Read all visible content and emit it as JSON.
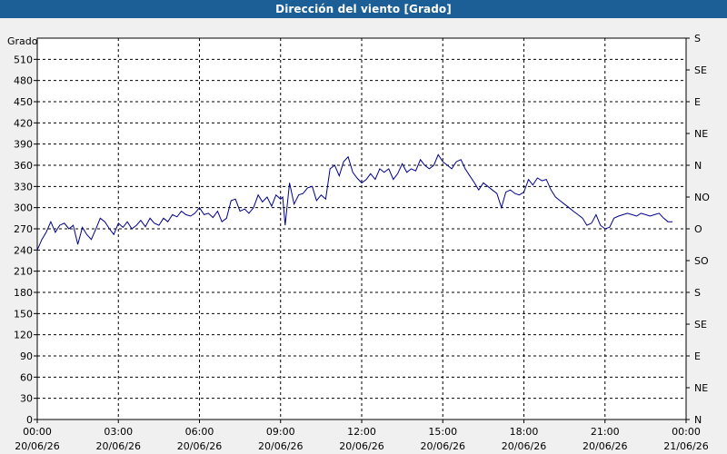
{
  "window": {
    "title": "Dirección del viento [Grado]"
  },
  "chart_data": {
    "type": "line",
    "title": "Dirección del viento [Grado]",
    "ylabel": "Grado",
    "xlabel": "",
    "ylim": [
      0,
      540
    ],
    "xlim": [
      "2026-06-20 00:00",
      "2026-06-21 00:00"
    ],
    "grid": true,
    "line_color": "#00008b",
    "y_ticks": [
      0,
      30,
      60,
      90,
      120,
      150,
      180,
      210,
      240,
      270,
      300,
      330,
      360,
      390,
      420,
      450,
      480,
      510
    ],
    "y_right_ticks": [
      "N",
      "NE",
      "E",
      "SE",
      "S",
      "SO",
      "O",
      "NO",
      "N",
      "NE",
      "E",
      "SE",
      "S"
    ],
    "y_right_tick_values": [
      0,
      45,
      90,
      135,
      180,
      225,
      270,
      315,
      360,
      405,
      450,
      495,
      540
    ],
    "x_ticks": [
      {
        "time": "00:00",
        "date": "20/06/26"
      },
      {
        "time": "03:00",
        "date": "20/06/26"
      },
      {
        "time": "06:00",
        "date": "20/06/26"
      },
      {
        "time": "09:00",
        "date": "20/06/26"
      },
      {
        "time": "12:00",
        "date": "20/06/26"
      },
      {
        "time": "15:00",
        "date": "20/06/26"
      },
      {
        "time": "18:00",
        "date": "20/06/26"
      },
      {
        "time": "21:00",
        "date": "20/06/26"
      },
      {
        "time": "00:00",
        "date": "21/06/26"
      }
    ],
    "series": [
      {
        "x_hours": [
          0,
          0.17,
          0.33,
          0.5,
          0.67,
          0.83,
          1,
          1.17,
          1.33,
          1.5,
          1.67,
          1.83,
          2,
          2.17,
          2.33,
          2.5,
          2.67,
          2.83,
          3,
          3.17,
          3.33,
          3.5,
          3.67,
          3.83,
          4,
          4.17,
          4.33,
          4.5,
          4.67,
          4.83,
          5,
          5.17,
          5.33,
          5.5,
          5.67,
          5.83,
          6,
          6.17,
          6.33,
          6.5,
          6.67,
          6.83,
          7,
          7.17,
          7.33,
          7.5,
          7.67,
          7.83,
          8,
          8.17,
          8.33,
          8.5,
          8.67,
          8.83,
          9,
          9.08,
          9.17,
          9.33,
          9.5,
          9.67,
          9.83,
          10,
          10.17,
          10.33,
          10.5,
          10.67,
          10.83,
          11,
          11.17,
          11.33,
          11.5,
          11.67,
          11.83,
          12,
          12.17,
          12.33,
          12.5,
          12.67,
          12.83,
          13,
          13.17,
          13.33,
          13.5,
          13.67,
          13.83,
          14,
          14.17,
          14.33,
          14.5,
          14.67,
          14.83,
          15,
          15.17,
          15.33,
          15.5,
          15.67,
          15.83,
          16,
          16.17,
          16.33,
          16.5,
          16.67,
          16.83,
          17,
          17.17,
          17.33,
          17.5,
          17.67,
          17.83,
          18,
          18.17,
          18.33,
          18.5,
          18.67,
          18.83,
          19,
          19.17,
          19.33,
          19.5,
          19.67,
          19.83,
          20,
          20.17,
          20.33,
          20.5,
          20.67,
          20.83,
          21,
          21.17,
          21.33,
          21.5,
          21.67,
          21.83,
          22,
          22.17,
          22.33,
          22.5,
          22.67,
          22.83,
          23,
          23.17,
          23.33,
          23.5,
          23.67,
          23.83,
          24
        ],
        "values": [
          240,
          255,
          265,
          280,
          265,
          275,
          278,
          270,
          275,
          248,
          272,
          262,
          255,
          270,
          285,
          280,
          270,
          262,
          278,
          272,
          280,
          270,
          275,
          282,
          273,
          285,
          278,
          275,
          285,
          280,
          290,
          287,
          295,
          290,
          288,
          292,
          300,
          290,
          292,
          286,
          295,
          280,
          285,
          310,
          312,
          295,
          298,
          292,
          300,
          318,
          308,
          315,
          302,
          318,
          312,
          315,
          275,
          335,
          305,
          318,
          320,
          328,
          330,
          310,
          318,
          312,
          355,
          360,
          345,
          365,
          372,
          350,
          342,
          335,
          340,
          348,
          340,
          355,
          350,
          355,
          340,
          348,
          362,
          350,
          355,
          352,
          368,
          360,
          355,
          360,
          375,
          365,
          360,
          355,
          365,
          368,
          355,
          345,
          335,
          325,
          335,
          330,
          325,
          320,
          300,
          322,
          325,
          320,
          318,
          322,
          340,
          332,
          342,
          338,
          340,
          325,
          315,
          310,
          305,
          300,
          295,
          290,
          285,
          275,
          278,
          290,
          275,
          270,
          272,
          285,
          288,
          290,
          292,
          290,
          288,
          292,
          290,
          288,
          290,
          292,
          285,
          280,
          280
        ]
      }
    ]
  }
}
